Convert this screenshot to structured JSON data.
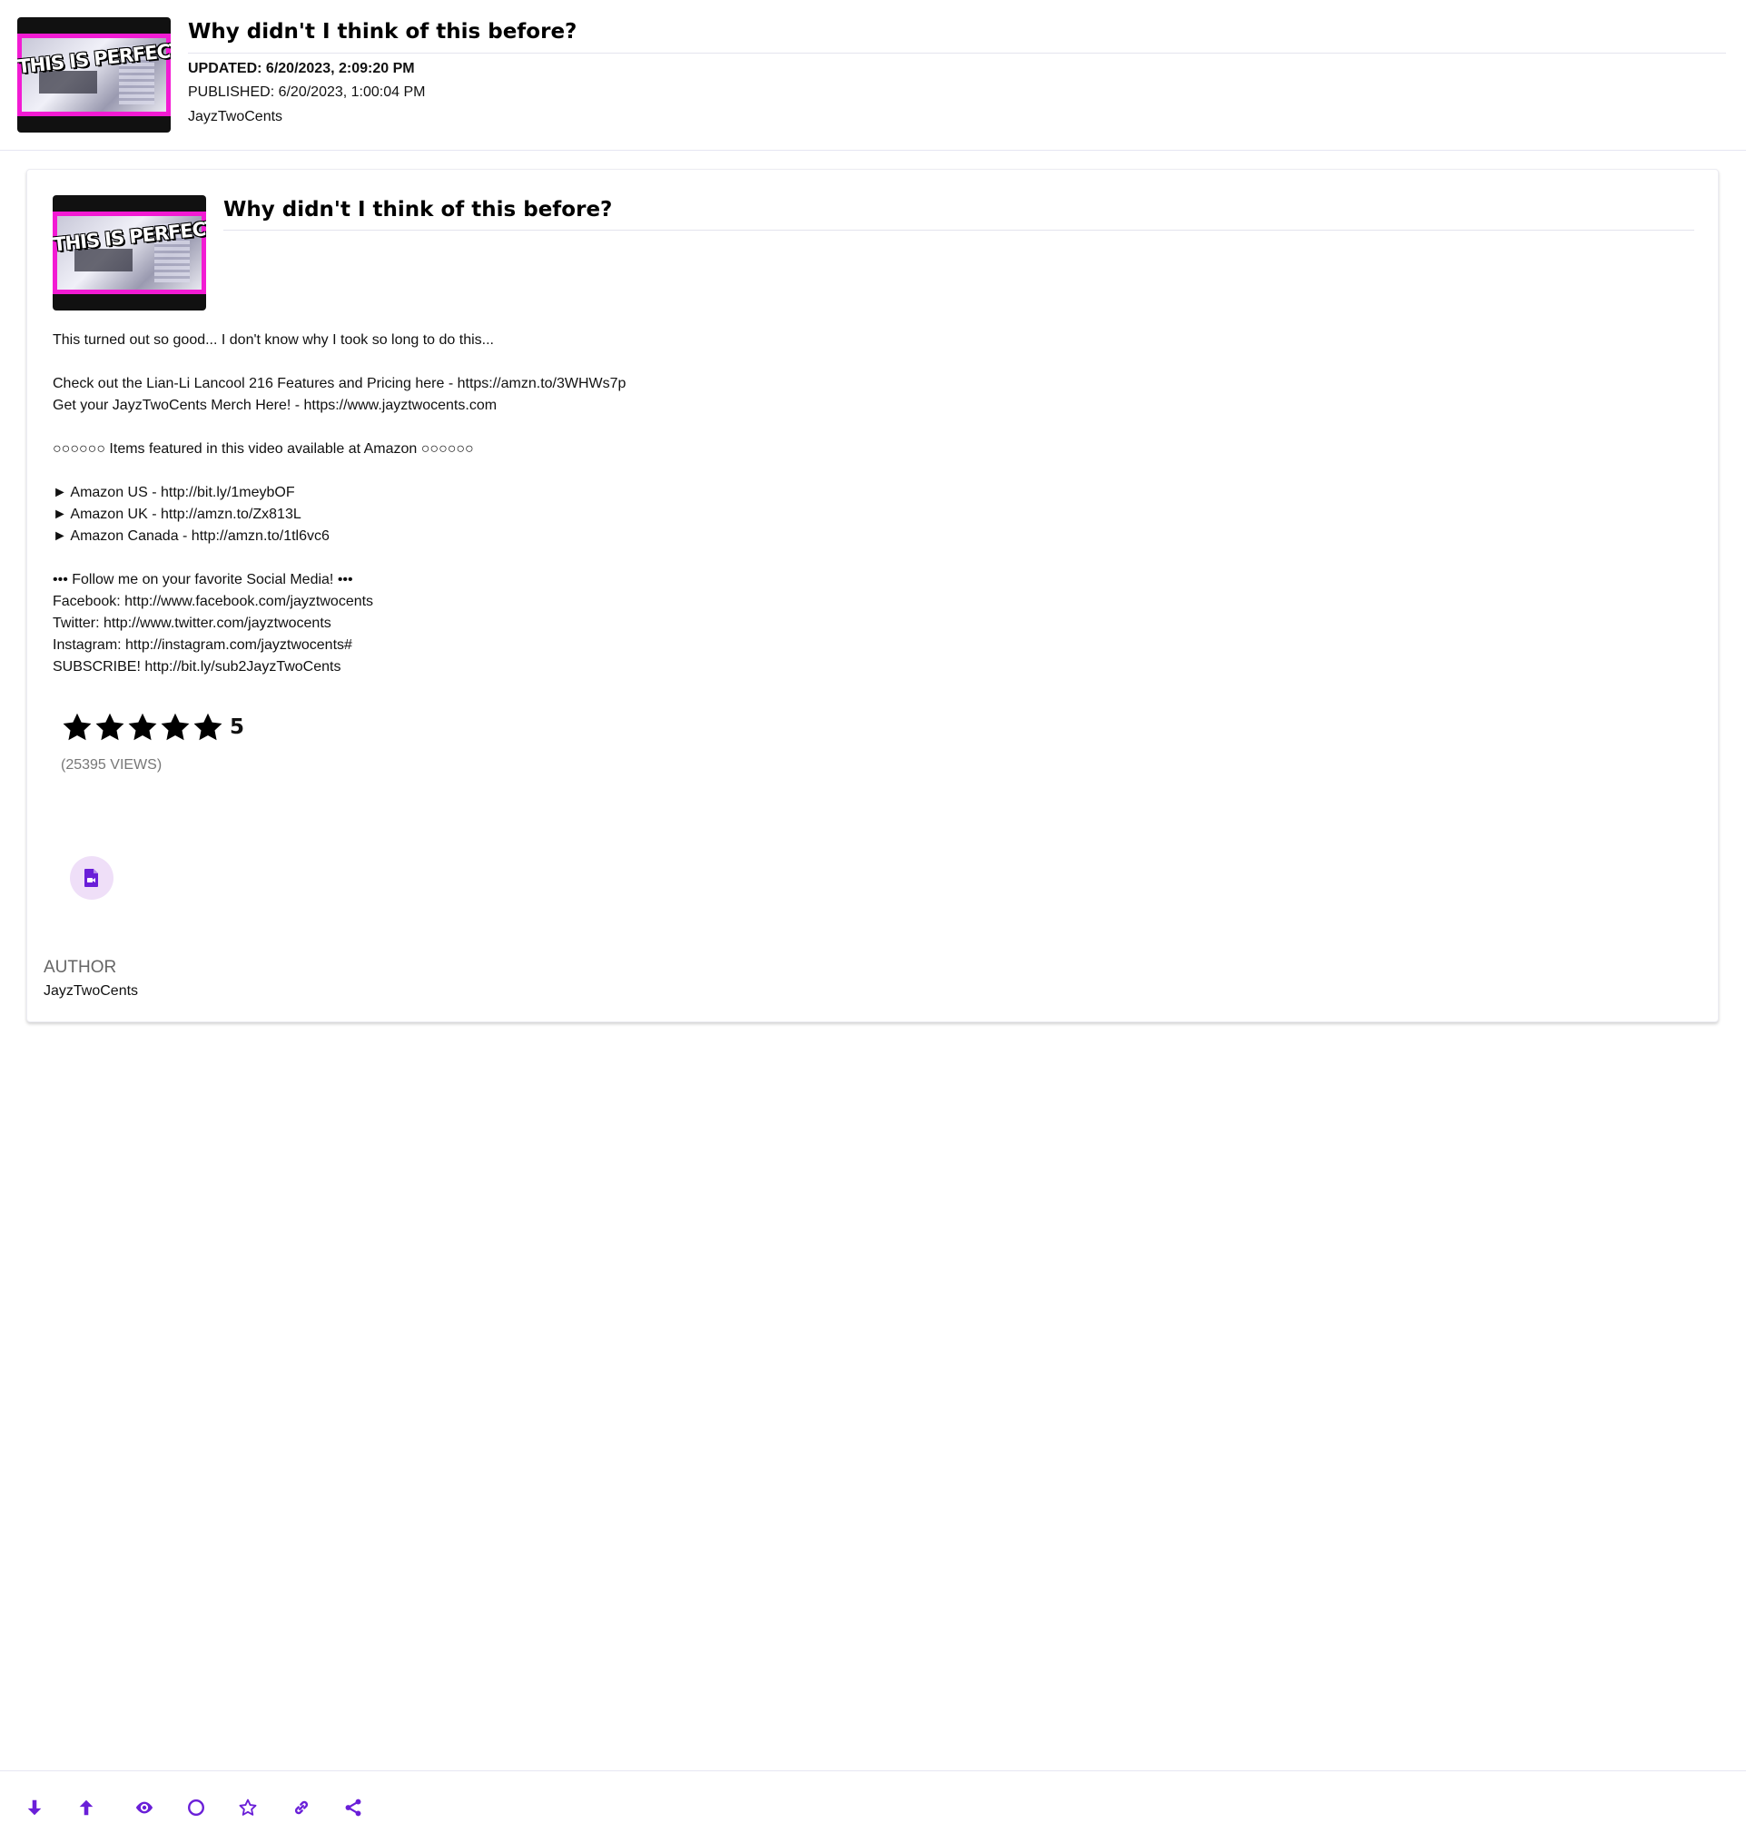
{
  "header": {
    "thumbnail_text": "THIS IS PERFECT!",
    "title": "Why didn't I think of this before?",
    "updated": "UPDATED: 6/20/2023, 2:09:20 PM",
    "published": "PUBLISHED: 6/20/2023, 1:00:04 PM",
    "author": "JayzTwoCents"
  },
  "card": {
    "thumbnail_text": "THIS IS PERFECT!",
    "title": "Why didn't I think of this before?",
    "description_lines": [
      "This turned out so good... I don't know why I took so long to do this...",
      "",
      "Check out the Lian-Li Lancool 216 Features and Pricing here - https://amzn.to/3WHWs7p",
      "Get your JayzTwoCents Merch Here! - https://www.jayztwocents.com",
      "",
      "○○○○○○ Items featured in this video available at Amazon ○○○○○○",
      "",
      "► Amazon US - http://bit.ly/1meybOF",
      "► Amazon UK - http://amzn.to/Zx813L",
      "► Amazon Canada - http://amzn.to/1tl6vc6",
      "",
      "••• Follow me on your favorite Social Media! •••",
      "Facebook: http://www.facebook.com/jayztwocents",
      "Twitter: http://www.twitter.com/jayztwocents",
      "Instagram: http://instagram.com/jayztwocents#",
      "SUBSCRIBE! http://bit.ly/sub2JayzTwoCents"
    ],
    "rating": {
      "value": "5",
      "stars_filled": 5,
      "stars_total": 5
    },
    "views": "(25395 VIEWS)",
    "file_button_icon": "file-video-icon",
    "author_label": "AUTHOR",
    "author_name": "JayzTwoCents"
  },
  "toolbar": {
    "accent_color": "#6a1fd8",
    "items": [
      {
        "icon": "arrow-down-icon"
      },
      {
        "icon": "arrow-up-icon"
      },
      {
        "icon": "eye-icon"
      },
      {
        "icon": "circle-icon"
      },
      {
        "icon": "star-outline-icon"
      },
      {
        "icon": "link-icon"
      },
      {
        "icon": "share-icon"
      }
    ]
  },
  "colors": {
    "accent": "#6a1fd8",
    "file_button_bg": "#efdff8",
    "thumbnail_border": "#f21bd3"
  }
}
